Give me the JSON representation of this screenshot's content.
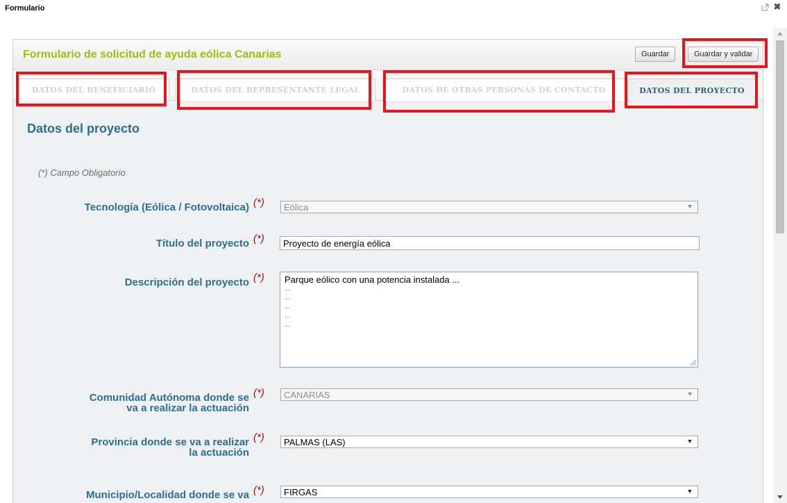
{
  "window": {
    "title": "Formulario"
  },
  "form": {
    "title": "Formulario de solicitud de ayuda eólica Canarias",
    "buttons": {
      "save": "Guardar",
      "save_validate": "Guardar y validar"
    },
    "tabs": [
      {
        "label": "DATOS DEL BENEFICIARIO",
        "active": false
      },
      {
        "label": "DATOS DEL REPRESENTANTE LEGAL",
        "active": false
      },
      {
        "label": "DATOS DE OTRAS PERSONAS DE CONTACTO",
        "active": false
      },
      {
        "label": "DATOS DEL PROYECTO",
        "active": true
      }
    ],
    "section_title": "Datos del proyecto",
    "required_note": "(*) Campo Obligatorio",
    "required_marker": "(*)",
    "fields": {
      "technology": {
        "label": "Tecnología (Eólica / Fotovoltaica)",
        "value": "Eólica"
      },
      "project_title": {
        "label": "Título del proyecto",
        "value": "Proyecto de energía eólica"
      },
      "description": {
        "label": "Descripción del proyecto",
        "lines": [
          "Parque eólico con una potencia instalada ...",
          "...",
          "...",
          "...",
          "...",
          "..."
        ]
      },
      "region": {
        "label_line1": "Comunidad Autónoma donde se",
        "label_line2": "va a realizar la actuación",
        "value": "CANARIAS"
      },
      "province": {
        "label_line1": "Provincia donde se va a realizar",
        "label_line2": "la actuación",
        "value": "PALMAS (LAS)"
      },
      "municipality": {
        "label_line1": "Municipio/Localidad donde se va",
        "value": "FIRGAS"
      }
    }
  },
  "colors": {
    "title_green": "#9bbf0f",
    "label_blue": "#2e6e94",
    "highlight_red": "#e8141c"
  }
}
